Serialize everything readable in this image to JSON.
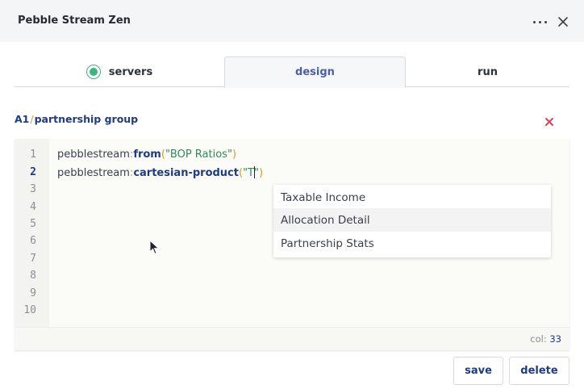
{
  "window": {
    "title": "Pebble Stream Zen"
  },
  "tabs": [
    {
      "label": "servers",
      "active": false
    },
    {
      "label": "design",
      "active": true
    },
    {
      "label": "run",
      "active": false
    }
  ],
  "breadcrumb": {
    "part1": "A1",
    "separator": "/",
    "part2": "partnership group"
  },
  "editor": {
    "line_numbers": [
      "1",
      "2",
      "3",
      "4",
      "5",
      "6",
      "7",
      "8",
      "9",
      "10"
    ],
    "active_line": "2",
    "lines": [
      {
        "ns": "pebblestream",
        "colon": ":",
        "fn": "from",
        "open": "(",
        "str": "\"BOP Ratios\"",
        "close": ")"
      },
      {
        "ns": "pebblestream",
        "colon": ":",
        "fn": "cartesian-product",
        "open": "(",
        "str_before_cursor": "\"T",
        "str_after_cursor": "\"",
        "close": ")"
      }
    ],
    "status": {
      "col_label": "col:",
      "col_value": "33"
    }
  },
  "autocomplete": {
    "items": [
      "Taxable Income",
      "Allocation Detail",
      "Partnership Stats"
    ],
    "hovered_index": 1
  },
  "actions": {
    "save_label": "save",
    "delete_label": "delete"
  },
  "colors": {
    "accent": "#1d3b86",
    "active_tab": "#4a5fa8",
    "status_ok": "#3bb77e",
    "danger": "#e0405a"
  },
  "icons": {
    "more": "more-horizontal-icon",
    "close": "close-icon",
    "remove": "remove-x-icon",
    "status": "radio-icon"
  }
}
